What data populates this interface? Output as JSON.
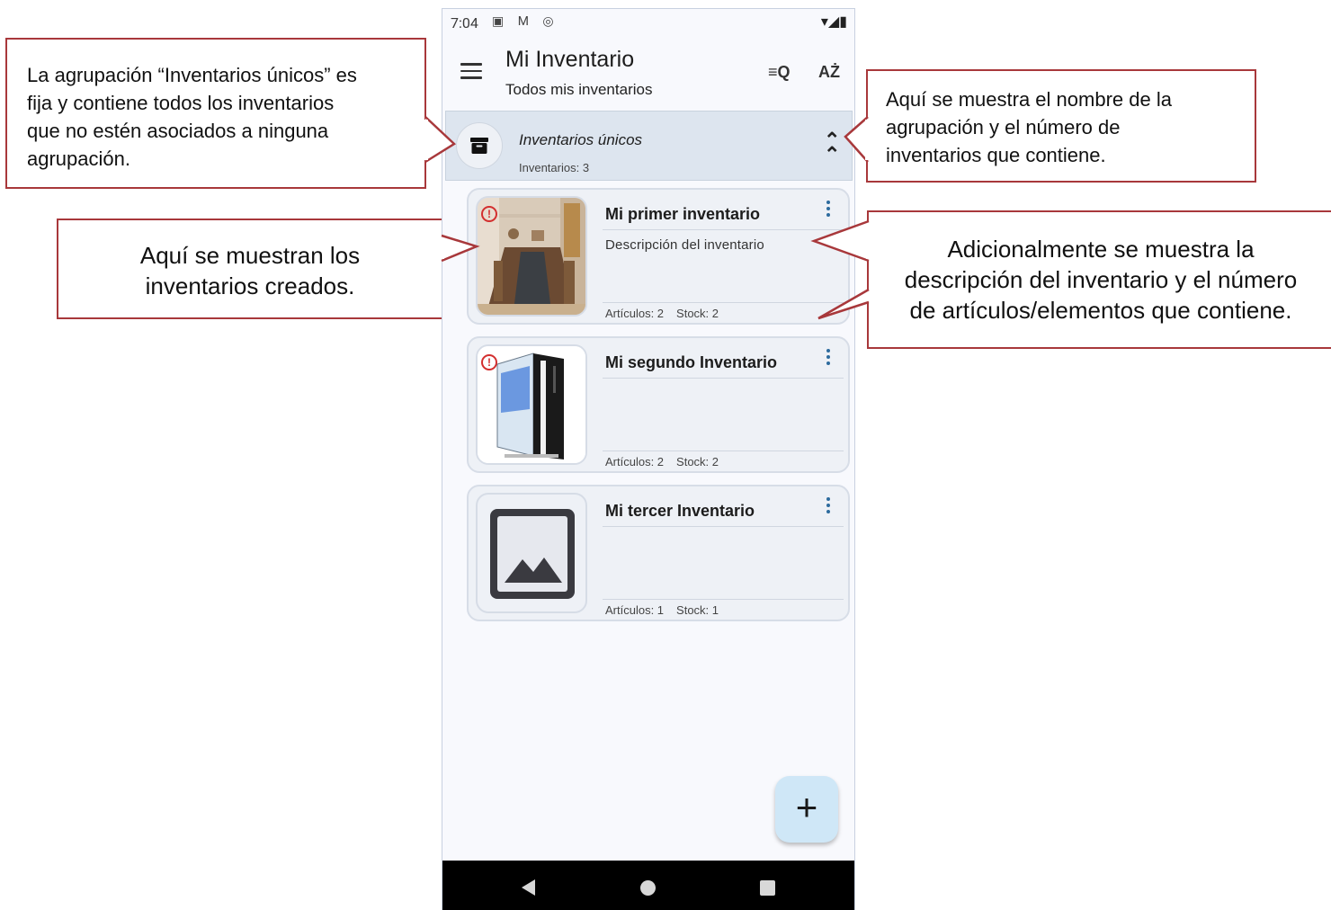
{
  "callouts": {
    "group_fixed": "La agrupación “Inventarios únicos” es\nfija y contiene todos los inventarios\nque no estén asociados a ninguna\nagrupación.",
    "inventories_shown": "Aquí se muestran los\ninventarios creados.",
    "group_name_count": "Aquí se muestra el nombre de la\nagrupación y el número de\ninventarios que contiene.",
    "description_count": "Adicionalmente se muestra la\ndescripción del inventario y el número\nde artículos/elementos que contiene."
  },
  "status_bar": {
    "time": "7:04"
  },
  "app_bar": {
    "title": "Mi Inventario",
    "subtitle": "Todos mis inventarios",
    "filter_icon": "filter-search-icon",
    "sort_icon": "sort-az-icon",
    "filter_glyph": "≡Q",
    "sort_glyph": "AŻ"
  },
  "group": {
    "name": "Inventarios únicos",
    "count": "Inventarios: 3"
  },
  "inventories": [
    {
      "title": "Mi primer inventario",
      "description": "Descripción del inventario",
      "articles": "Artículos: 2",
      "stock": "Stock: 2",
      "warning": true,
      "image": "dining-room-photo"
    },
    {
      "title": "Mi segundo Inventario",
      "description": "",
      "articles": "Artículos: 2",
      "stock": "Stock: 2",
      "warning": true,
      "image": "pc-tower-photo"
    },
    {
      "title": "Mi tercer Inventario",
      "description": "",
      "articles": "Artículos: 1",
      "stock": "Stock: 1",
      "warning": false,
      "image": "image-placeholder-icon"
    }
  ],
  "fab": {
    "label": "+"
  },
  "colors": {
    "callout_border": "#a8383b",
    "group_bg": "#dde5ef",
    "card_bg": "#eef1f6",
    "fab_bg": "#cfe7f7",
    "warning": "#d32f2f",
    "accent": "#2d6b9e"
  }
}
